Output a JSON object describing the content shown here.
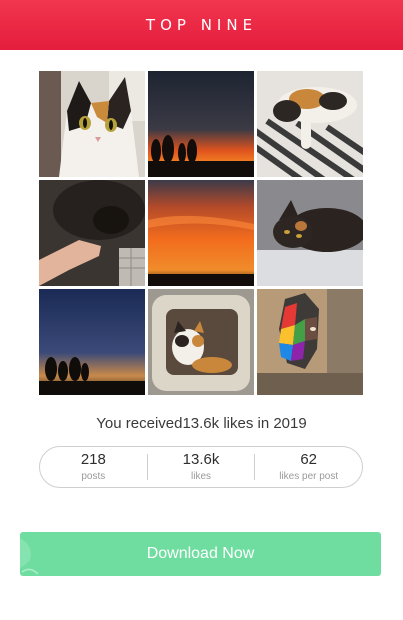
{
  "header": {
    "title": "TOP NINE"
  },
  "grid": {
    "tiles": [
      {
        "icon": "calico-cat-portrait-photo"
      },
      {
        "icon": "sunset-trees-silhouette-photo"
      },
      {
        "icon": "calico-cat-lying-on-striped-blanket-photo"
      },
      {
        "icon": "black-cat-and-hand-photo"
      },
      {
        "icon": "orange-sunset-sky-photo"
      },
      {
        "icon": "tortoiseshell-cat-lying-photo"
      },
      {
        "icon": "dusk-tree-silhouette-photo"
      },
      {
        "icon": "calico-cat-in-cat-tree-photo"
      },
      {
        "icon": "colorful-gorilla-mural-photo"
      }
    ]
  },
  "summary": {
    "text": "You received13.6k likes in 2019"
  },
  "stats": [
    {
      "value": "218",
      "label": "posts"
    },
    {
      "value": "13.6k",
      "label": "likes"
    },
    {
      "value": "62",
      "label": "likes per post"
    }
  ],
  "download": {
    "label": "Download Now"
  },
  "colors": {
    "header": "#e8243f",
    "download": "#6fdca0",
    "border": "#cfcfcf"
  }
}
